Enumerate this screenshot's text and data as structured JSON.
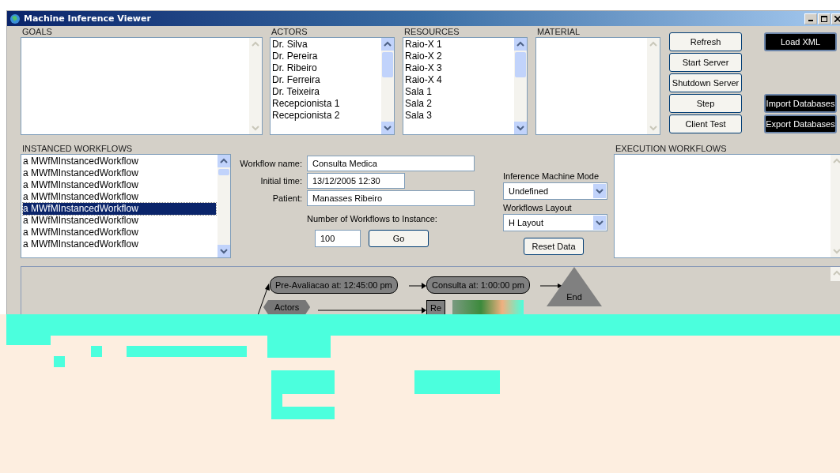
{
  "window": {
    "title": "Machine Inference Viewer"
  },
  "lists": [
    {
      "label": "GOALS",
      "scroll_thumb": false,
      "kind": "wide"
    },
    {
      "label": "ACTORS",
      "items": [
        "Dr. Silva",
        "Dr. Pereira",
        "Dr. Ribeiro",
        "Dr. Ferreira",
        "Dr. Teixeira",
        "Recepcionista 1",
        "Recepcionista 2"
      ],
      "scroll_thumb": true,
      "kind": "narrow"
    },
    {
      "label": "RESOURCES",
      "items": [
        "Raio-X 1",
        "Raio-X 2",
        "Raio-X 3",
        "Raio-X 4",
        "Sala 1",
        "Sala 2",
        "Sala 3"
      ],
      "scroll_thumb": true,
      "kind": "narrow"
    },
    {
      "label": "MATERIAL",
      "scroll_thumb": false,
      "kind": "narrow"
    }
  ],
  "action_buttons": [
    "Refresh",
    "Start Server",
    "Shutdown Server",
    "Step",
    "Client Test"
  ],
  "database_buttons": [
    {
      "label": "Load XML",
      "kind": "top"
    },
    {
      "label": "Import Databases",
      "kind": "bottom"
    },
    {
      "label": "Export Databases",
      "kind": "bottom"
    }
  ],
  "instanced_workflows": {
    "label": "INSTANCED WORKFLOWS",
    "items": [
      {
        "text": "a MWfMInstancedWorkflow",
        "selected": false
      },
      {
        "text": "a MWfMInstancedWorkflow",
        "selected": false
      },
      {
        "text": "a MWfMInstancedWorkflow",
        "selected": false
      },
      {
        "text": "a MWfMInstancedWorkflow",
        "selected": false
      },
      {
        "text": "a MWfMInstancedWorkflow",
        "selected": true
      },
      {
        "text": "a MWfMInstancedWorkflow",
        "selected": false
      },
      {
        "text": "a MWfMInstancedWorkflow",
        "selected": false
      },
      {
        "text": "a MWfMInstancedWorkflow",
        "selected": false
      }
    ]
  },
  "form": {
    "fields": [
      {
        "label": "Workflow name:",
        "value": "Consulta Medica",
        "kind": "long"
      },
      {
        "label": "Initial time:",
        "value": "13/12/2005 12:30",
        "kind": "short"
      },
      {
        "label": "Patient:",
        "value": "Manasses Ribeiro",
        "kind": "long"
      }
    ],
    "count_label": "Number of Workflows to Instance:",
    "count_value": "100",
    "go_button": "Go"
  },
  "mode": {
    "mode_label": "Inference Machine Mode",
    "mode_value": "Undefined",
    "layout_label": "Workflows Layout",
    "layout_value": "H Layout",
    "reset_button": "Reset Data"
  },
  "execution_workflows": {
    "label": "EXECUTION WORKFLOWS"
  },
  "diagram": {
    "nodes": [
      {
        "label": "Pre-Avaliacao at: 12:45:00 pm",
        "kind": "task"
      },
      {
        "label": "Consulta at: 1:00:00 pm",
        "kind": "task"
      },
      {
        "label": "End",
        "kind": "end"
      },
      {
        "label": "Actors",
        "kind": "hex"
      },
      {
        "label": "Re",
        "kind": "rect"
      }
    ]
  }
}
